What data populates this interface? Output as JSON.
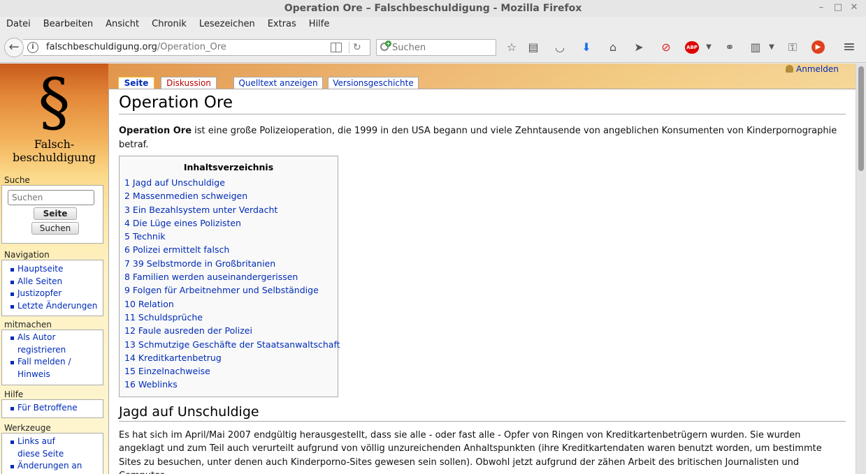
{
  "window": {
    "title": "Operation Ore – Falschbeschuldigung - Mozilla Firefox",
    "controls": [
      "–",
      "□",
      "✕"
    ]
  },
  "menu": [
    {
      "label": "Datei"
    },
    {
      "label": "Bearbeiten"
    },
    {
      "label": "Ansicht"
    },
    {
      "label": "Chronik"
    },
    {
      "label": "Lesezeichen"
    },
    {
      "label": "Extras"
    },
    {
      "label": "Hilfe"
    }
  ],
  "navbar": {
    "url_domain": "falschbeschuldigung.org",
    "url_path": "/Operation_Ore",
    "search_placeholder": "Suchen",
    "back_glyph": "←",
    "reload_glyph": "↻",
    "info_glyph": "i",
    "toolbar_icons": [
      {
        "name": "bookmark-star-icon",
        "glyph": "☆"
      },
      {
        "name": "library-icon",
        "glyph": "▤"
      },
      {
        "name": "pocket-icon",
        "glyph": "◡"
      },
      {
        "name": "download-icon",
        "glyph": "⬇"
      },
      {
        "name": "home-icon",
        "glyph": "⌂"
      },
      {
        "name": "send-icon",
        "glyph": "➤"
      },
      {
        "name": "block-icon",
        "glyph": "⊘"
      },
      {
        "name": "adblock-icon",
        "glyph": "ABP"
      },
      {
        "name": "extension-icon",
        "glyph": "⚭"
      },
      {
        "name": "clipboard-icon",
        "glyph": "▥"
      },
      {
        "name": "lock-user-icon",
        "glyph": "⚿"
      },
      {
        "name": "media-icon",
        "glyph": "▶"
      },
      {
        "name": "hamburger-menu-icon",
        "glyph": "≡"
      }
    ]
  },
  "site": {
    "logo_symbol": "§",
    "logo_line1": "Falsch-",
    "logo_line2": "beschuldigung",
    "login": "Anmelden"
  },
  "sidebar": {
    "search": {
      "heading": "Suche",
      "placeholder": "Suchen",
      "go_label": "Seite",
      "search_label": "Suchen"
    },
    "navigation": {
      "heading": "Navigation",
      "items": [
        "Hauptseite",
        "Alle Seiten",
        "Justizopfer",
        "Letzte Änderungen"
      ]
    },
    "mitmachen": {
      "heading": "mitmachen",
      "items": [
        "Als Autor registrieren",
        "Fall melden / Hinweis"
      ]
    },
    "hilfe": {
      "heading": "Hilfe",
      "items": [
        "Für Betroffene"
      ]
    },
    "werkzeuge": {
      "heading": "Werkzeuge",
      "items": [
        "Links auf diese Seite",
        "Änderungen an"
      ]
    }
  },
  "tabs": [
    {
      "label": "Seite",
      "selected": true
    },
    {
      "label": "Diskussion",
      "new": true
    },
    {
      "label": "Quelltext anzeigen"
    },
    {
      "label": "Versionsgeschichte"
    }
  ],
  "article": {
    "title": "Operation Ore",
    "intro_bold": "Operation Ore",
    "intro_rest": " ist eine große Polizeioperation, die 1999 in den USA begann und viele Zehntausende von angeblichen Konsumenten von Kinderpornographie betraf.",
    "toc_title": "Inhaltsverzeichnis",
    "toc": [
      "1 Jagd auf Unschuldige",
      "2 Massenmedien schweigen",
      "3 Ein Bezahlsystem unter Verdacht",
      "4 Die Lüge eines Polizisten",
      "5 Technik",
      "6 Polizei ermittelt falsch",
      "7 39 Selbstmorde in Großbritanien",
      "8 Familien werden auseinandergerissen",
      "9 Folgen für Arbeitnehmer und Selbständige",
      "10 Relation",
      "11 Schuldsprüche",
      "12 Faule ausreden der Polizei",
      "13 Schmutzige Geschäfte der Staatsanwaltschaft",
      "14 Kreditkartenbetrug",
      "15 Einzelnachweise",
      "16 Weblinks"
    ],
    "section1_heading": "Jagd auf Unschuldige",
    "section1_text": "Es hat sich im April/Mai 2007 endgültig herausgestellt, dass sie alle - oder fast alle - Opfer von Ringen von Kreditkartenbetrügern wurden. Sie wurden angeklagt und zum Teil auch verurteilt aufgrund von völlig unzureichenden Anhaltspunkten (ihre Kreditkartendaten waren benutzt worden, um bestimmte Sites zu besuchen, unter denen auch Kinderporno-Sites gewesen sein sollen). Obwohl jetzt aufgrund der zähen Arbeit des britischen Journalisten und Computer-"
  },
  "colors": {
    "link": "#002bb8",
    "new_link": "#ba0000",
    "tab_selected_border": "#fabd23"
  }
}
